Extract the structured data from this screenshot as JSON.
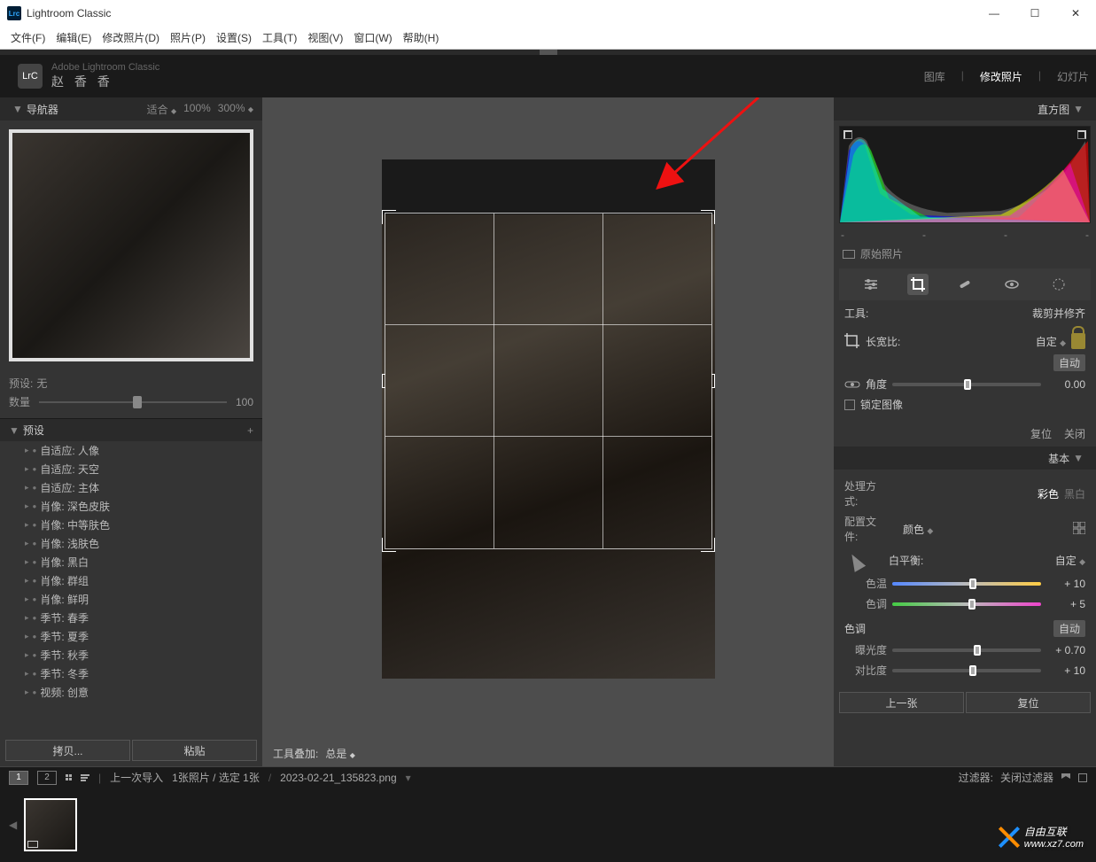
{
  "window": {
    "title": "Lightroom Classic",
    "minimize": "—",
    "maximize": "☐",
    "close": "✕"
  },
  "menu": [
    "文件(F)",
    "编辑(E)",
    "修改照片(D)",
    "照片(P)",
    "设置(S)",
    "工具(T)",
    "视图(V)",
    "窗口(W)",
    "帮助(H)"
  ],
  "header": {
    "app_label": "Adobe Lightroom Classic",
    "user": "赵 香 香",
    "logo": "LrC",
    "modules": {
      "library": "图库",
      "develop": "修改照片",
      "slideshow": "幻灯片"
    }
  },
  "navigator": {
    "title": "导航器",
    "fit": "适合",
    "z100": "100%",
    "z300": "300%",
    "preset_label": "预设:",
    "preset_value": "无",
    "amount_label": "数量",
    "amount_value": "100"
  },
  "presets": {
    "title": "预设",
    "items": [
      "自适应: 人像",
      "自适应: 天空",
      "自适应: 主体",
      "肖像: 深色皮肤",
      "肖像: 中等肤色",
      "肖像: 浅肤色",
      "肖像: 黑白",
      "肖像: 群组",
      "肖像: 鲜明",
      "季节: 春季",
      "季节: 夏季",
      "季节: 秋季",
      "季节: 冬季",
      "视频: 创意"
    ],
    "copy_btn": "拷贝...",
    "paste_btn": "粘贴"
  },
  "center": {
    "tool_overlay_label": "工具叠加:",
    "tool_overlay_value": "总是"
  },
  "right": {
    "histogram_title": "直方图",
    "original_label": "原始照片",
    "tool_label": "工具:",
    "tool_name": "裁剪并修齐",
    "aspect_label": "长宽比:",
    "aspect_value": "自定",
    "angle_label": "角度",
    "angle_auto": "自动",
    "angle_value": "0.00",
    "lock_label": "锁定图像",
    "reset": "复位",
    "close": "关闭",
    "basic_title": "基本",
    "treatment_label": "处理方式:",
    "treatment_color": "彩色",
    "treatment_bw": "黑白",
    "profile_label": "配置文件:",
    "profile_value": "颜色",
    "wb_label": "白平衡:",
    "wb_value": "自定",
    "temp_label": "色温",
    "temp_value": "+ 10",
    "tint_label": "色调",
    "tint_value": "+ 5",
    "tone_label": "色调",
    "tone_auto": "自动",
    "exposure_label": "曝光度",
    "exposure_value": "+ 0.70",
    "contrast_label": "对比度",
    "contrast_value": "+ 10",
    "prev_btn": "上一张",
    "reset_btn": "复位"
  },
  "filmstrip": {
    "last_import": "上一次导入",
    "count": "1张照片 / 选定 1张",
    "filename": "2023-02-21_135823.png",
    "filter_label": "过滤器:",
    "filter_value": "关闭过滤器"
  },
  "watermark": {
    "text": "自由互联",
    "url": "www.xz7.com"
  }
}
